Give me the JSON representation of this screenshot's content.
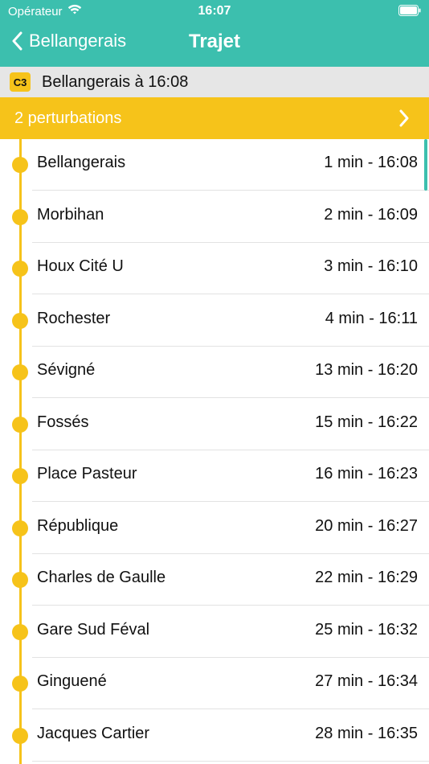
{
  "status_bar": {
    "carrier": "Opérateur",
    "time": "16:07",
    "wifi_icon": "wifi-icon",
    "battery_icon": "battery-icon"
  },
  "nav": {
    "back_label": "Bellangerais",
    "title": "Trajet"
  },
  "line": {
    "badge": "C3",
    "text": "Bellangerais à 16:08"
  },
  "perturbations": {
    "label": "2 perturbations"
  },
  "stops": [
    {
      "name": "Bellangerais",
      "eta": "1 min - 16:08"
    },
    {
      "name": "Morbihan",
      "eta": "2 min - 16:09"
    },
    {
      "name": "Houx Cité U",
      "eta": "3 min - 16:10"
    },
    {
      "name": "Rochester",
      "eta": "4 min - 16:11"
    },
    {
      "name": "Sévigné",
      "eta": "13 min - 16:20"
    },
    {
      "name": "Fossés",
      "eta": "15 min - 16:22"
    },
    {
      "name": "Place Pasteur",
      "eta": "16 min - 16:23"
    },
    {
      "name": "République",
      "eta": "20 min - 16:27"
    },
    {
      "name": "Charles de Gaulle",
      "eta": "22 min - 16:29"
    },
    {
      "name": "Gare Sud Féval",
      "eta": "25 min - 16:32"
    },
    {
      "name": "Ginguené",
      "eta": "27 min - 16:34"
    },
    {
      "name": "Jacques Cartier",
      "eta": "28 min - 16:35"
    }
  ],
  "colors": {
    "header": "#3cbfae",
    "accent_yellow": "#f6c31a",
    "banner_gray": "#e6e6e6"
  }
}
